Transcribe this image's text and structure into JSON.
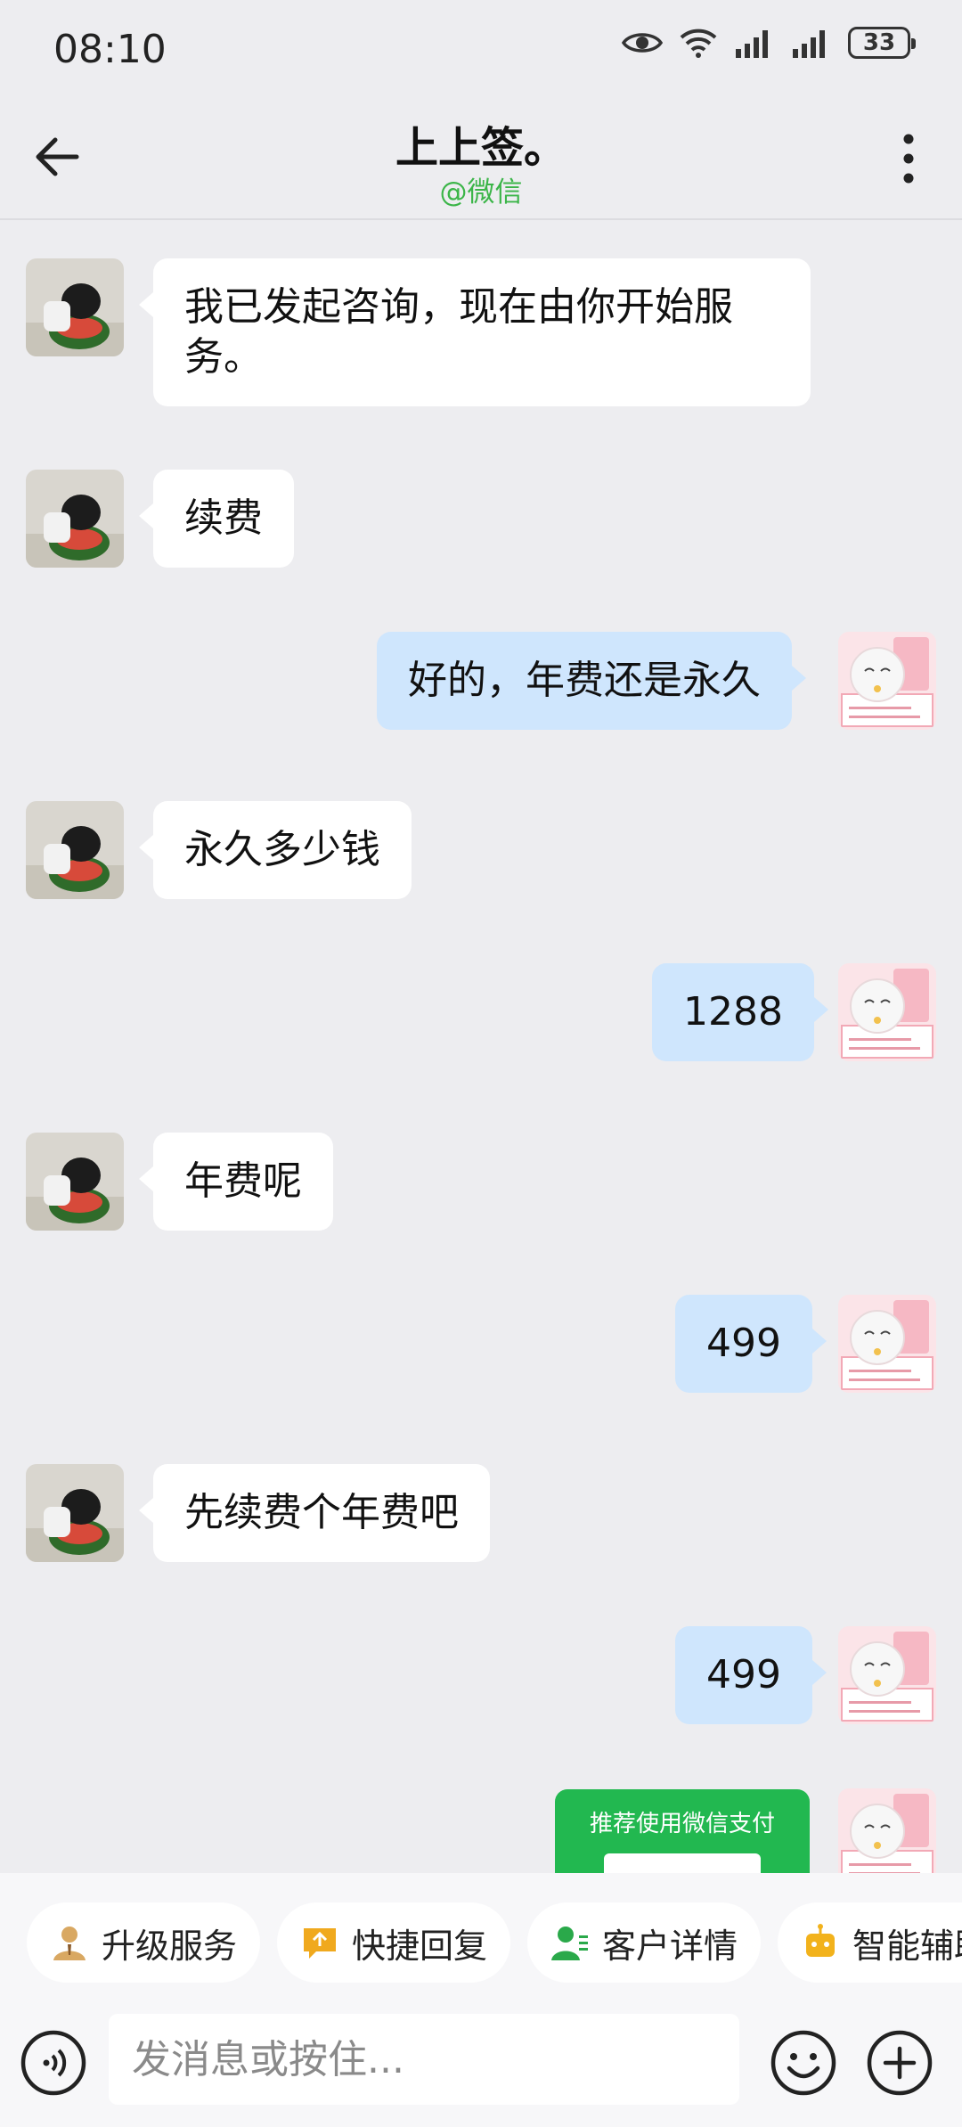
{
  "status_bar": {
    "time": "08:10",
    "battery": "33"
  },
  "header": {
    "title": "上上签。",
    "subtitle": "@微信"
  },
  "messages": [
    {
      "side": "in",
      "text": "我已发起咨询，现在由你开始服务。"
    },
    {
      "side": "in",
      "text": "续费"
    },
    {
      "side": "out",
      "text": "好的，年费还是永久"
    },
    {
      "side": "in",
      "text": "永久多少钱"
    },
    {
      "side": "out",
      "text": "1288"
    },
    {
      "side": "in",
      "text": "年费呢"
    },
    {
      "side": "out",
      "text": "499"
    },
    {
      "side": "in",
      "text": "先续费个年费吧"
    },
    {
      "side": "out",
      "text": "499"
    }
  ],
  "pay_card": {
    "title": "推荐使用微信支付"
  },
  "quick_actions": [
    {
      "label": "升级服务",
      "icon": "user-icon"
    },
    {
      "label": "快捷回复",
      "icon": "quick-reply-icon"
    },
    {
      "label": "客户详情",
      "icon": "customer-icon"
    },
    {
      "label": "智能辅助",
      "icon": "robot-icon"
    }
  ],
  "input": {
    "placeholder": "发消息或按住..."
  },
  "colors": {
    "accent_green": "#3bb548",
    "out_bubble": "#cfe6fd",
    "pay_green": "#22b850"
  }
}
